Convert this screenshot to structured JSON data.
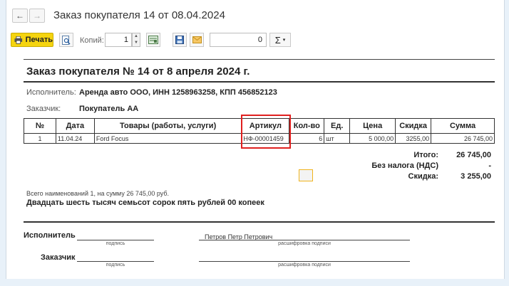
{
  "window": {
    "title": "Заказ покупателя 14 от 08.04.2024"
  },
  "nav": {
    "back_glyph": "←",
    "forward_glyph": "→"
  },
  "toolbar": {
    "print_label": "Печать",
    "copies_label": "Копий:",
    "copies_value": "1",
    "sum_value": "0",
    "sigma_label": "Σ",
    "icons": [
      "preview-icon",
      "print-settings-icon",
      "save-icon",
      "email-icon",
      "sigma-icon"
    ]
  },
  "document": {
    "title": "Заказ покупателя № 14 от 8 апреля 2024 г.",
    "executor_label": "Исполнитель:",
    "executor_value": "Аренда авто ООО, ИНН 1258963258, КПП 456852123",
    "customer_label": "Заказчик:",
    "customer_value": "Покупатель АА",
    "table": {
      "headers": [
        "№",
        "Дата",
        "Товары (работы, услуги)",
        "Артикул",
        "Кол-во",
        "Ед.",
        "Цена",
        "Скидка",
        "Сумма"
      ],
      "rows": [
        [
          "1",
          "11.04.24",
          "Ford Focus",
          "НФ-00001459",
          "6",
          "шт",
          "5 000,00",
          "3255,00",
          "26 745,00"
        ]
      ]
    },
    "totals": {
      "total_label": "Итого:",
      "total_value": "26 745,00",
      "vat_label": "Без налога (НДС)",
      "vat_value": "-",
      "discount_label": "Скидка:",
      "discount_value": "3 255,00"
    },
    "count_line": "Всего наименований 1, на сумму 26 745,00 руб.",
    "words_line": "Двадцать шесть тысяч семьсот сорок пять рублей 00 копеек",
    "signatures": {
      "executor_label": "Исполнитель",
      "customer_label": "Заказчик",
      "signature_caption": "подпись",
      "decode_caption": "расшифровка подписи",
      "executor_name": "Петров Петр Петрович"
    }
  },
  "colors": {
    "accent": "#f5d40f",
    "highlight": "#e0201f",
    "background": "#e8f1f9"
  }
}
